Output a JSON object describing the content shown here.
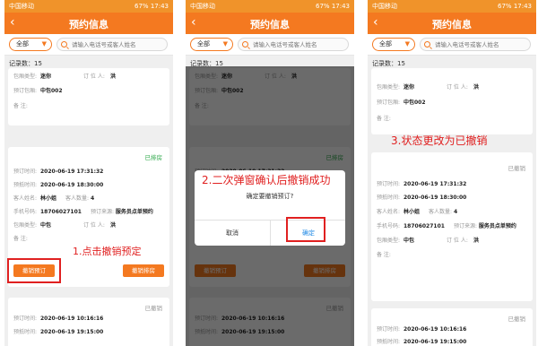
{
  "status_bar": {
    "carrier": "中国移动",
    "battery": "67%",
    "time": "17:43"
  },
  "header": {
    "back_icon": "‹",
    "title": "预约信息"
  },
  "filter": {
    "select_value": "全部",
    "search_placeholder": "请输入电话号或客人姓名"
  },
  "record_count": "记录数：15",
  "labels": {
    "create_time": "预订时间:",
    "arrive_time": "预抵时间:",
    "guest_name": "客人姓名:",
    "guest_count": "客人数量:",
    "phone": "手机号码:",
    "source": "预订来源:",
    "room_type": "包厢类型:",
    "booker": "订 位 人:",
    "room": "预订包厢:",
    "remark": "备    注:"
  },
  "top_card": {
    "room_type": "迷你",
    "booker": "洪",
    "room": "中包002"
  },
  "main_card": {
    "status_arranged": "已排房",
    "status_cancelled": "已撤销",
    "create_time": "2020-06-19 17:31:32",
    "arrive_time": "2020-06-19 18:30:00",
    "guest_name": "林小姐",
    "guest_count": "4",
    "phone": "18706027101",
    "source": "服务员点单预约",
    "room_type": "中包",
    "booker": "洪",
    "cancel_button": "撤销预订",
    "cancel_arrange_button": "撤销排房"
  },
  "bottom_card": {
    "status": "已撤销",
    "create_time": "2020-06-19 10:16:16",
    "arrive_time": "2020-06-19 19:15:00"
  },
  "dialog": {
    "message": "确定要撤销预订?",
    "cancel": "取消",
    "confirm": "确定"
  },
  "annotations": {
    "step1": "1.点击撤销预定",
    "step2": "2.二次弹窗确认后撤销成功",
    "step3": "3.状态更改为已撤销"
  },
  "colors": {
    "brand_orange": "#f47920",
    "status_green": "#2ea84a",
    "annotation_red": "#e02020"
  }
}
